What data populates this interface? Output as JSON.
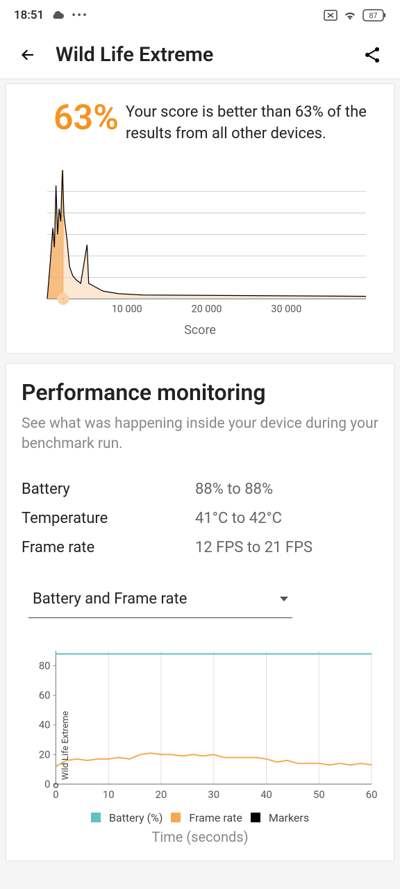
{
  "status": {
    "time": "18:51",
    "battery": "87"
  },
  "header": {
    "title": "Wild Life Extreme"
  },
  "score": {
    "percent": "63%",
    "description": "Your score is better than 63% of the results from all other devices."
  },
  "chart_data": [
    {
      "type": "area",
      "title": "",
      "xlabel": "Score",
      "ylabel": "",
      "xlim": [
        0,
        40000
      ],
      "ylim": [
        0,
        100
      ],
      "xticks": [
        10000,
        20000,
        30000
      ],
      "xtick_labels": [
        "10 000",
        "20 000",
        "30 000"
      ],
      "marker_x": 2000,
      "series": [
        {
          "name": "distribution",
          "x": [
            0,
            400,
            700,
            900,
            1100,
            1300,
            1500,
            1700,
            1900,
            2100,
            2300,
            2500,
            2800,
            3200,
            3600,
            4200,
            5000,
            5200,
            5800,
            7000,
            8000,
            9000,
            12000,
            40000
          ],
          "values": [
            0,
            30,
            55,
            40,
            88,
            50,
            70,
            60,
            100,
            65,
            55,
            45,
            25,
            18,
            15,
            12,
            42,
            12,
            10,
            6,
            5,
            4,
            3,
            2
          ]
        }
      ]
    },
    {
      "type": "line",
      "title": "",
      "xlabel": "Time (seconds)",
      "ylabel": "Wild Life Extreme",
      "xlim": [
        0,
        60
      ],
      "ylim": [
        0,
        90
      ],
      "xticks": [
        0,
        10,
        20,
        30,
        40,
        50,
        60
      ],
      "yticks": [
        0,
        20,
        40,
        60,
        80
      ],
      "legend": [
        "Battery (%)",
        "Frame rate",
        "Markers"
      ],
      "legend_colors": [
        "#5ec0c0",
        "#f5a94f",
        "#000000"
      ],
      "series": [
        {
          "name": "Battery (%)",
          "x": [
            0,
            5,
            10,
            15,
            20,
            25,
            30,
            35,
            40,
            45,
            50,
            55,
            60
          ],
          "values": [
            88,
            88,
            88,
            88,
            88,
            88,
            88,
            88,
            88,
            88,
            88,
            88,
            88
          ]
        },
        {
          "name": "Frame rate",
          "x": [
            0,
            2,
            4,
            6,
            8,
            10,
            12,
            14,
            16,
            18,
            20,
            22,
            24,
            26,
            28,
            30,
            32,
            34,
            36,
            38,
            40,
            42,
            44,
            46,
            48,
            50,
            52,
            54,
            56,
            58,
            60
          ],
          "values": [
            12,
            16,
            17,
            16,
            17,
            17,
            18,
            17,
            20,
            21,
            20,
            20,
            19,
            20,
            19,
            20,
            18,
            18,
            18,
            18,
            17,
            15,
            16,
            14,
            14,
            14,
            13,
            14,
            13,
            14,
            13
          ]
        }
      ]
    }
  ],
  "perf": {
    "title": "Performance monitoring",
    "desc": "See what was happening inside your device during your benchmark run.",
    "rows": [
      {
        "label": "Battery",
        "value": "88% to 88%"
      },
      {
        "label": "Temperature",
        "value": "41°C to 42°C"
      },
      {
        "label": "Frame rate",
        "value": "12 FPS to 21 FPS"
      }
    ],
    "dropdown": "Battery and Frame rate"
  }
}
